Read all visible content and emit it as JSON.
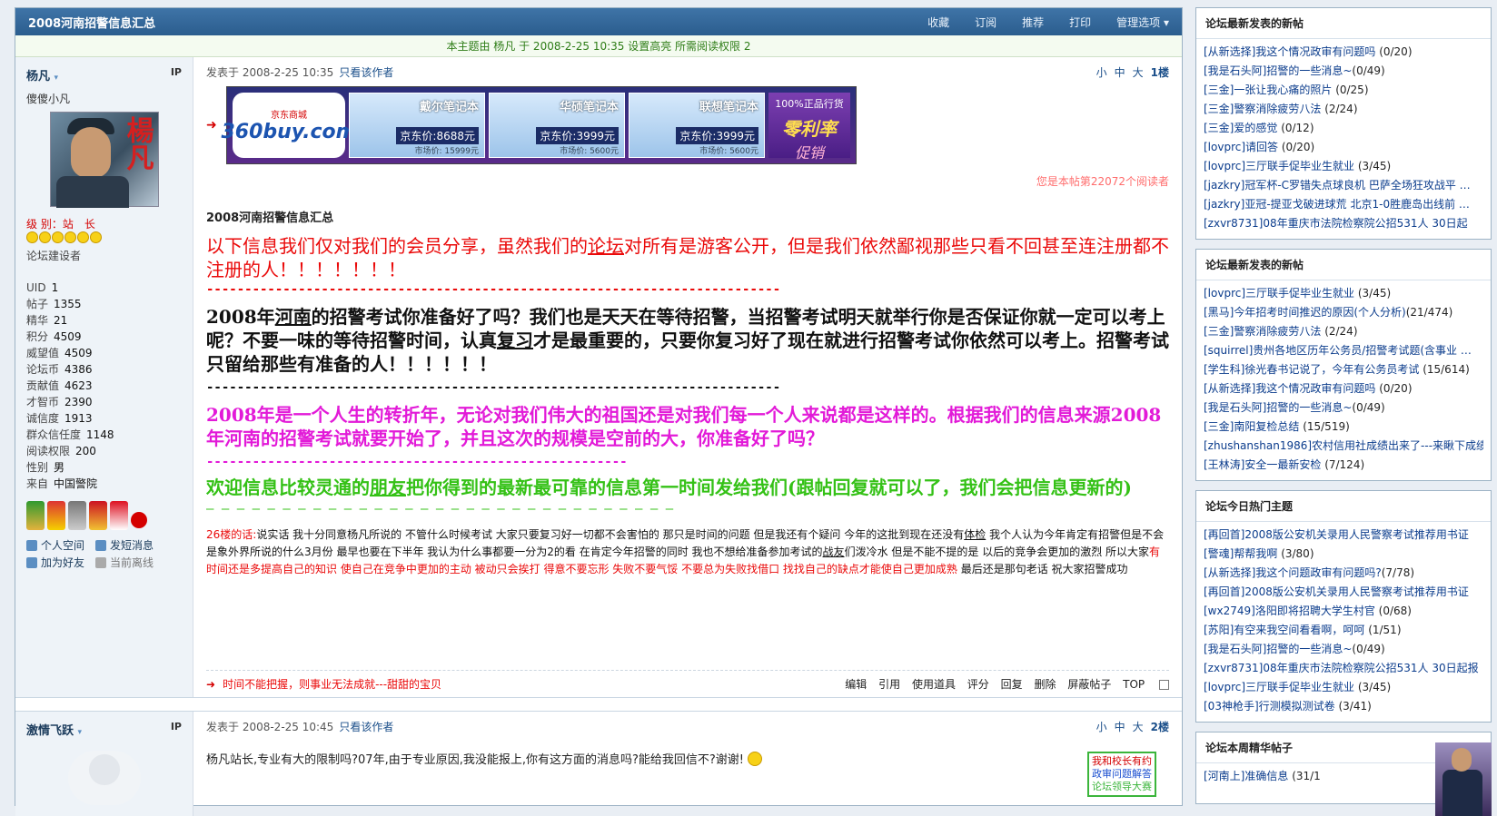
{
  "thread": {
    "title": "2008河南招警信息汇总",
    "actions": [
      "收藏",
      "订阅",
      "推荐",
      "打印",
      "管理选项 ▾"
    ],
    "notice": "本主题由 杨凡 于 2008-2-25 10:35 设置高亮 所需阅读权限 2"
  },
  "post1": {
    "author": "杨凡",
    "ip_label": "IP",
    "user_title": "傻傻小凡",
    "avatar_char": "楊凡",
    "rank": "级 别：站　长",
    "builder": "论坛建设者",
    "stats": [
      {
        "k": "UID",
        "v": "1"
      },
      {
        "k": "帖子",
        "v": "1355"
      },
      {
        "k": "精华",
        "v": "21"
      },
      {
        "k": "积分",
        "v": "4509"
      },
      {
        "k": "威望值",
        "v": "4509"
      },
      {
        "k": "论坛币",
        "v": "4386"
      },
      {
        "k": "贡献值",
        "v": "4623"
      },
      {
        "k": "才智币",
        "v": "2390"
      },
      {
        "k": "诚信度",
        "v": "1913"
      },
      {
        "k": "群众信任度",
        "v": "1148"
      },
      {
        "k": "阅读权限",
        "v": "200"
      },
      {
        "k": "性别",
        "v": "男"
      },
      {
        "k": "来自",
        "v": "中国警院"
      }
    ],
    "links": [
      "个人空间",
      "发短消息",
      "加为好友",
      "当前离线"
    ],
    "posted_at": "发表于 2008-2-25 10:35",
    "only_author": "只看该作者",
    "font_sizes": [
      "小",
      "中",
      "大"
    ],
    "floor": "1楼",
    "ad": {
      "logo": "360buy.com",
      "logo_sub": "京东商城",
      "items": [
        {
          "name": "戴尔笔记本",
          "price": "京东价:8688元",
          "old": "市场价: 15999元"
        },
        {
          "name": "华硕笔记本",
          "price": "京东价:3999元",
          "old": "市场价: 5600元"
        },
        {
          "name": "联想笔记本",
          "price": "京东价:3999元",
          "old": "市场价: 5600元"
        }
      ],
      "promo_top": "100%正品行货",
      "promo_mid": "零利率",
      "promo_bot": "促销"
    },
    "guest_notice": "您是本帖第22072个阅读者",
    "post_title": "2008河南招警信息汇总",
    "p1a": "以下信息我们仅对我们的会员分享，虽然我们的",
    "p1link": "论坛",
    "p1b": "对所有是游客公开，但是我们依然鄙视那些只看不回甚至连注册都不注册的人！！！！！！！",
    "hr1": "---------------------------------------------------------------------------",
    "p2a": "2008年",
    "p2link1": "河南",
    "p2b": "的招警考试你准备好了吗？我们也是天天在等待招警，当招警考试明天就举行你是否保证你就一定可以考上呢？不要一味的等待招警时间，认真",
    "p2link2": "复习",
    "p2c": "才是最重要的，只要你复习好了现在就进行招警考试你依然可以考上。招警考试只留给那些有准备的人！！！！！！",
    "hr2": "---------------------------------------------------------------------------",
    "p3": "2008年是一个人生的转折年，无论对我们伟大的祖国还是对我们每一个人来说都是这样的。根据我们的信息来源2008年河南的招警考试就要开始了，并且这次的规模是空前的大，你准备好了吗？",
    "hr3": "-------------------------------------------------------",
    "p4a": "欢迎信息比较灵通的",
    "p4link": "朋友",
    "p4b": "把你得到的最新最可靠的信息第一时间发给我们(跟帖回复就可以了，我们会把信息更新的)",
    "hr4": "— — — — — — — — — — — — — — — — — — — — — — — — — — — — — — —",
    "f26_tag": "26楼的话:",
    "f26_a": "说实话 我十分同意杨凡所说的 不管什么时候考试 大家只要复习好一切都不会害怕的 那只是时间的问题 但是我还有个疑问 今年的这批到现在还没有",
    "f26_link1": "体检",
    "f26_b": " 我个人认为今年肯定有招警但是不会是象外界所说的什么3月份 最早也要在下半年 我认为什么事都要一分为2的看 在肯定今年招警的同时 我也不想给准备参加考试的",
    "f26_link2": "战友",
    "f26_c": "们泼冷水 但是不能不提的是 以后的竞争会更加的激烈 所以大家",
    "f26_hl": "有时间还是多提高自己的知识 使自己在竞争中更加的主动 被动只会挨打 得意不要忘形 失败不要气馁 不要总为失败找借口 找找自己的缺点才能使自己更加成熟",
    "f26_d": " 最后还是那句老话 祝大家招警成功",
    "signature": "时间不能把握，则事业无法成就---甜甜的宝贝",
    "ops": [
      "编辑",
      "引用",
      "使用道具",
      "评分",
      "回复",
      "删除",
      "屏蔽帖子",
      "TOP"
    ]
  },
  "post2": {
    "author": "激情飞跃",
    "ip_label": "IP",
    "posted_at": "发表于 2008-2-25 10:45",
    "only_author": "只看该作者",
    "font_sizes": [
      "小",
      "中",
      "大"
    ],
    "floor": "2楼",
    "body": "杨凡站长,专业有大的限制吗?07年,由于专业原因,我没能报上,你有这方面的消息吗?能给我回信不?谢谢!",
    "ad_lines": [
      "我和校长有约",
      "政审问题解答",
      "论坛领导大赛"
    ]
  },
  "panels": [
    {
      "title": "论坛最新发表的新帖",
      "items": [
        {
          "t": "[从新选择]我这个情况政审有问题吗",
          "c": " (0/20)"
        },
        {
          "t": "[我是石头阿]招警的一些消息~",
          "c": "(0/49)"
        },
        {
          "t": "[三金]一张让我心痛的照片",
          "c": " (0/25)"
        },
        {
          "t": "[三金]警察消除疲劳八法",
          "c": " (2/24)"
        },
        {
          "t": "[三金]爱的感觉",
          "c": " (0/12)"
        },
        {
          "t": "[lovprc]请回答",
          "c": " (0/20)"
        },
        {
          "t": "[lovprc]三厅联手促毕业生就业",
          "c": " (3/45)"
        },
        {
          "t": "[jazkry]冠军杯-C罗错失点球良机 巴萨全场狂攻战平 …",
          "c": ""
        },
        {
          "t": "[jazkry]亚冠-提亚戈破进球荒 北京1-0胜鹿岛出线前 …",
          "c": ""
        },
        {
          "t": "[zxvr8731]08年重庆市法院检察院公招531人 30日起",
          "c": ""
        }
      ]
    },
    {
      "title": "论坛最新发表的新帖",
      "items": [
        {
          "t": "[lovprc]三厅联手促毕业生就业",
          "c": " (3/45)"
        },
        {
          "t": "[黑马]今年招考时间推迟的原因(个人分析)",
          "c": "(21/474)"
        },
        {
          "t": "[三金]警察消除疲劳八法",
          "c": " (2/24)"
        },
        {
          "t": "[squirrel]贵州各地区历年公务员/招警考试题(含事业 …",
          "c": ""
        },
        {
          "t": "[学生科]徐光春书记说了，今年有公务员考试",
          "c": " (15/614)"
        },
        {
          "t": "[从新选择]我这个情况政审有问题吗",
          "c": " (0/20)"
        },
        {
          "t": "[我是石头阿]招警的一些消息~",
          "c": "(0/49)"
        },
        {
          "t": "[三金]南阳复检总结",
          "c": " (15/519)"
        },
        {
          "t": "[zhushanshan1986]农村信用社成绩出来了---来瞅下成绩",
          "c": ""
        },
        {
          "t": "[王林涛]安全一最新安检",
          "c": " (7/124)"
        }
      ]
    },
    {
      "title": "论坛今日热门主题",
      "items": [
        {
          "t": "[再回首]2008版公安机关录用人民警察考试推荐用书证",
          "c": ""
        },
        {
          "t": "[警魂]帮帮我啊",
          "c": " (3/80)"
        },
        {
          "t": "[从新选择]我这个问题政审有问题吗?",
          "c": "(7/78)"
        },
        {
          "t": "[再回首]2008版公安机关录用人民警察考试推荐用书证",
          "c": ""
        },
        {
          "t": "[wx2749]洛阳即将招聘大学生村官",
          "c": " (0/68)"
        },
        {
          "t": "[苏阳]有空来我空间看看啊，呵呵",
          "c": " (1/51)"
        },
        {
          "t": "[我是石头阿]招警的一些消息~",
          "c": "(0/49)"
        },
        {
          "t": "[zxvr8731]08年重庆市法院检察院公招531人 30日起报",
          "c": ""
        },
        {
          "t": "[lovprc]三厅联手促毕业生就业",
          "c": " (3/45)"
        },
        {
          "t": "[03神枪手]行测模拟测试卷",
          "c": " (3/41)"
        }
      ]
    },
    {
      "title": "论坛本周精华帖子",
      "items": [
        {
          "t": "[河南上]准确信息",
          "c": " (31/1"
        }
      ]
    }
  ]
}
